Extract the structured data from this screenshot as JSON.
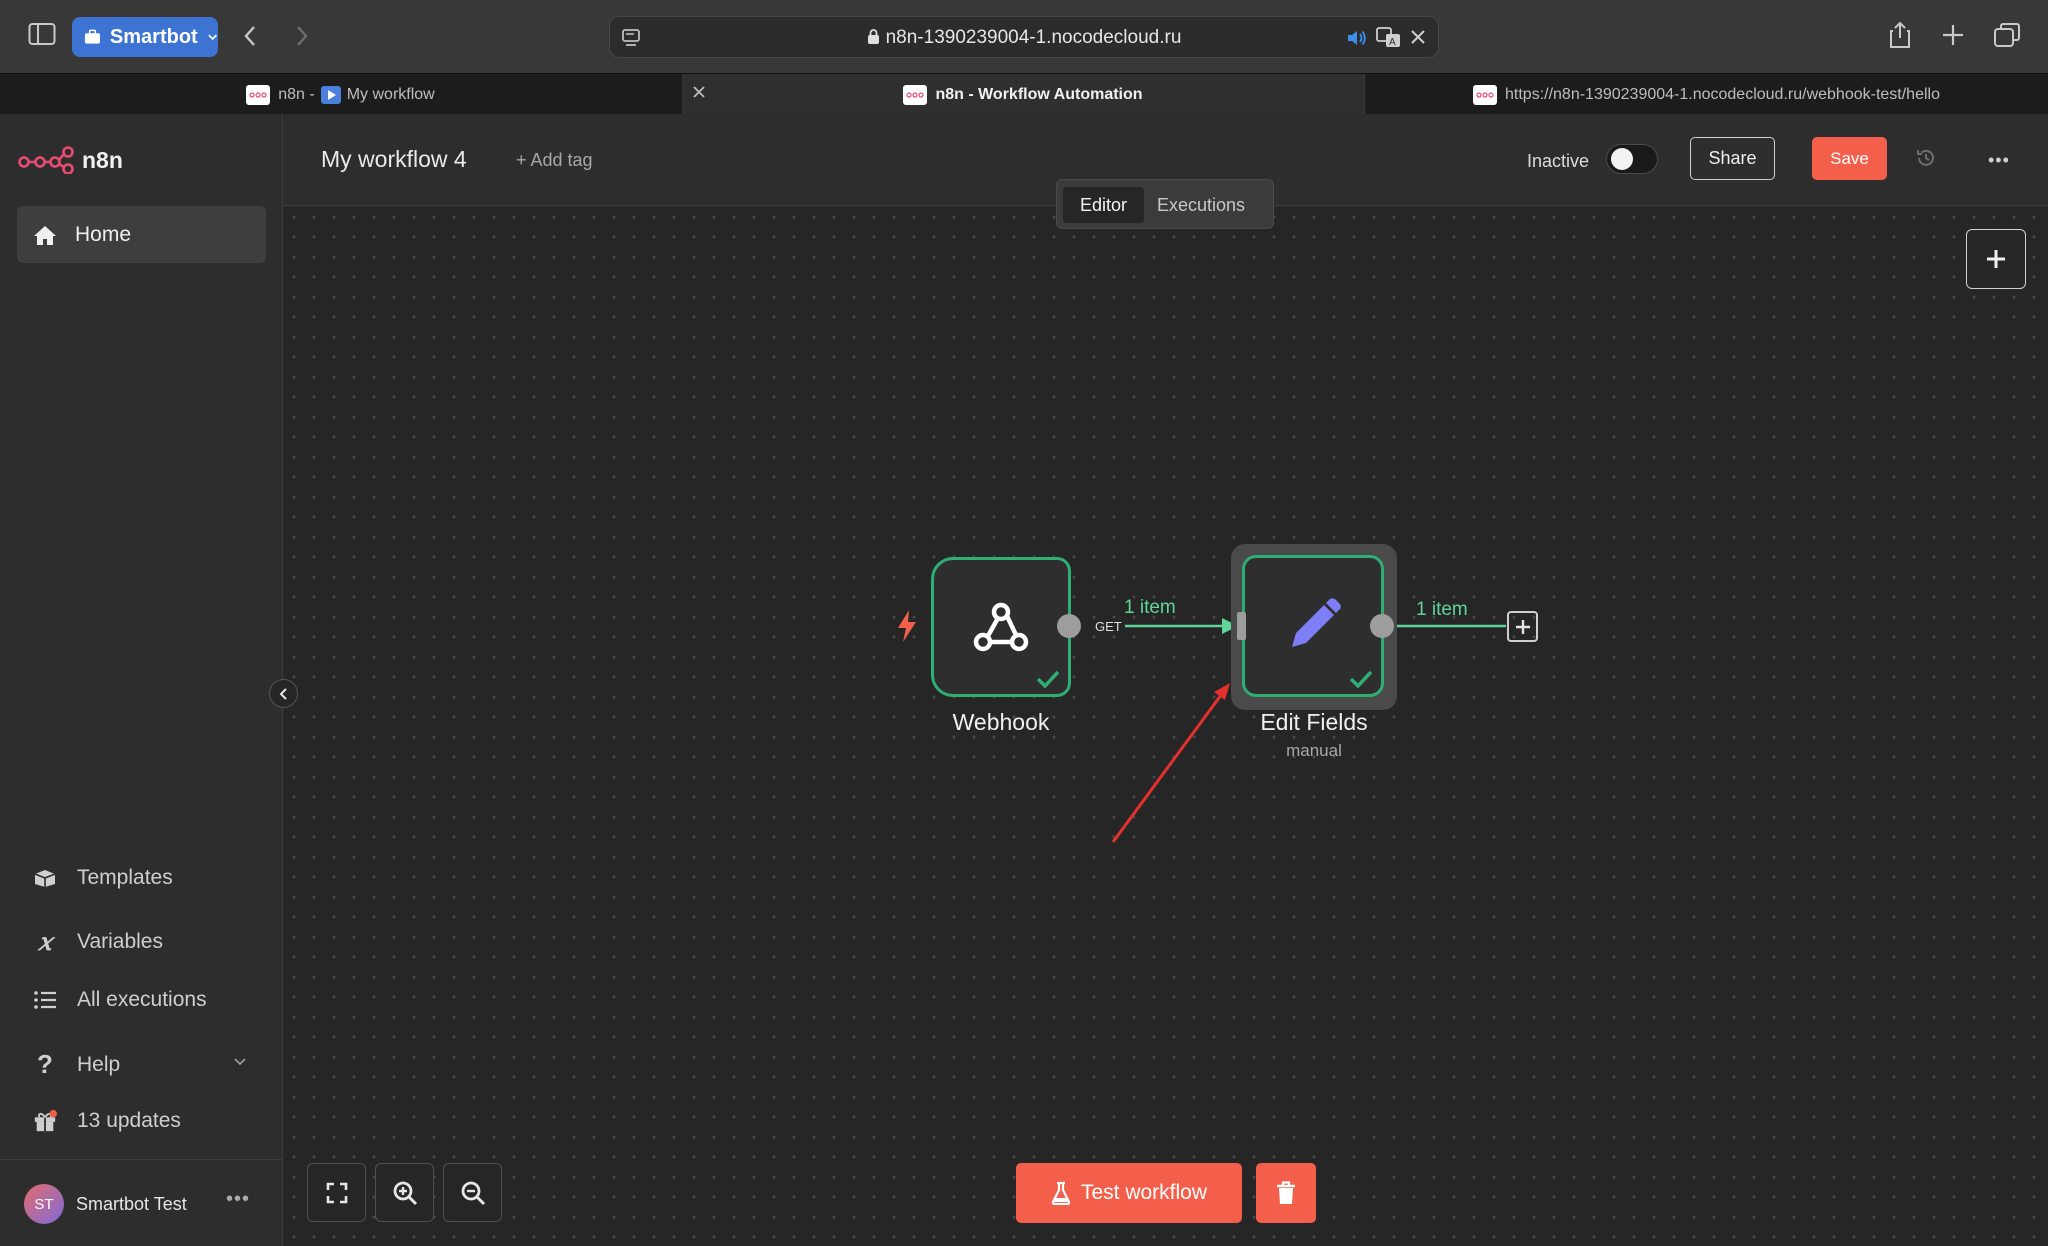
{
  "browser": {
    "profile_label": "Smartbot",
    "url": "n8n-1390239004-1.nocodecloud.ru",
    "tabs": [
      {
        "prefix": "n8n -",
        "title": "My workflow"
      },
      {
        "title": "n8n - Workflow Automation"
      },
      {
        "title": "https://n8n-1390239004-1.nocodecloud.ru/webhook-test/hello"
      }
    ]
  },
  "sidebar": {
    "logo_text": "n8n",
    "home_label": "Home",
    "items": [
      {
        "label": "Templates",
        "icon": "box-icon"
      },
      {
        "label": "Variables",
        "icon": "variable-icon"
      },
      {
        "label": "All executions",
        "icon": "list-icon"
      },
      {
        "label": "Help",
        "icon": "question-icon"
      },
      {
        "label": "13 updates",
        "icon": "gift-icon"
      }
    ],
    "user": {
      "initials": "ST",
      "name": "Smartbot Test"
    }
  },
  "header": {
    "workflow_name": "My workflow 4",
    "add_tag": "+ Add tag",
    "active_label": "Inactive",
    "active": false,
    "share_label": "Share",
    "save_label": "Save",
    "tabs": {
      "editor": "Editor",
      "executions": "Executions"
    }
  },
  "canvas": {
    "nodes": [
      {
        "name": "Webhook",
        "subtitle": "",
        "status": "success"
      },
      {
        "name": "Edit Fields",
        "subtitle": "manual",
        "status": "success"
      }
    ],
    "edges": [
      {
        "from": "Webhook",
        "to": "Edit Fields",
        "label": "1 item",
        "method": "GET"
      },
      {
        "from": "Edit Fields",
        "to": "add-node",
        "label": "1 item"
      }
    ],
    "test_button": "Test workflow"
  },
  "colors": {
    "accent": "#f45f4b",
    "success": "#2fae74",
    "edit_icon": "#7e7ef6",
    "annotation_arrow": "#e5312d"
  }
}
